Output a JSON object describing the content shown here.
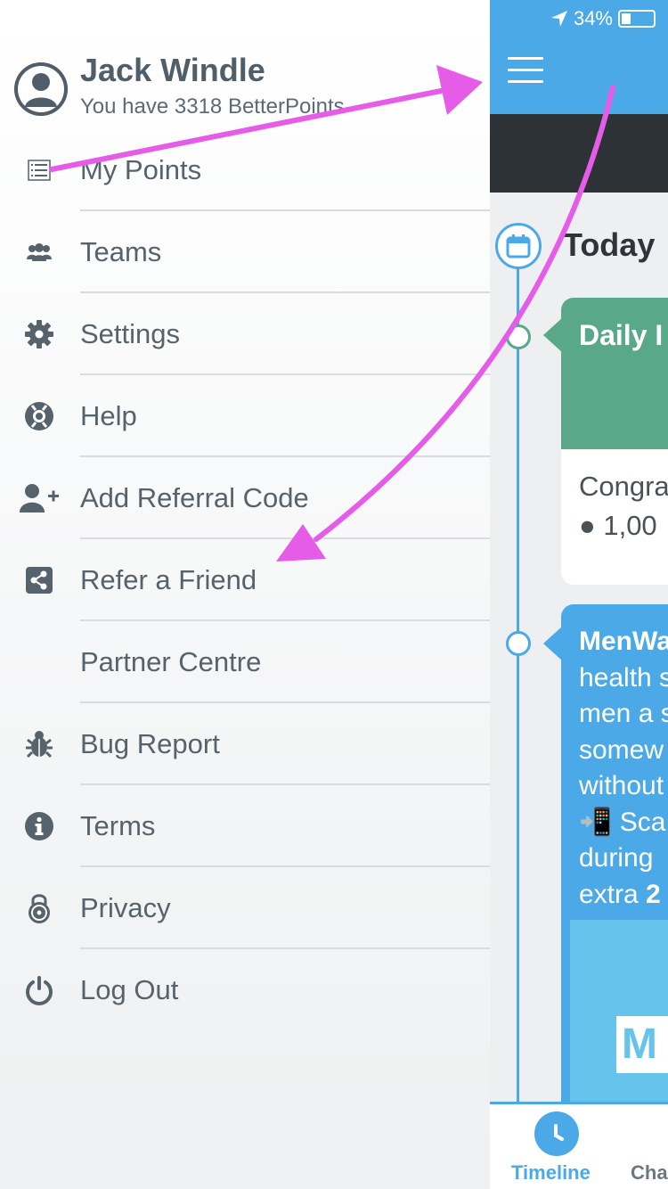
{
  "colors": {
    "primary_blue": "#4aa9e6",
    "green_card": "#5aa88a",
    "dark_band": "#2d3237",
    "menu_text": "#56636c",
    "annotation": "#e55ce8"
  },
  "status_bar": {
    "battery_text": "34%",
    "icons": [
      "location-arrow-icon",
      "battery-icon"
    ]
  },
  "profile": {
    "name": "Jack Windle",
    "subtitle": "You have 3318 BetterPoints"
  },
  "menu": {
    "items": [
      {
        "label": "My Points",
        "icon": "list-icon"
      },
      {
        "label": "Teams",
        "icon": "users-icon"
      },
      {
        "label": "Settings",
        "icon": "gear-icon"
      },
      {
        "label": "Help",
        "icon": "lifebuoy-icon"
      },
      {
        "label": "Add Referral Code",
        "icon": "user-plus-icon"
      },
      {
        "label": "Refer a Friend",
        "icon": "share-icon"
      },
      {
        "label": "Partner Centre",
        "icon": ""
      },
      {
        "label": "Bug Report",
        "icon": "bug-icon"
      },
      {
        "label": "Terms",
        "icon": "info-icon"
      },
      {
        "label": "Privacy",
        "icon": "padlock-icon"
      },
      {
        "label": "Log Out",
        "icon": "power-icon"
      }
    ]
  },
  "timeline": {
    "section_label": "Today",
    "card1": {
      "title": "Daily I",
      "line1": "Congra",
      "line2": "●  1,00"
    },
    "card2": {
      "line1": "MenWa",
      "line2": "health s",
      "line3": "men a s",
      "line4": "somew",
      "line5": "without",
      "line6": "📲 Sca",
      "line7": "during",
      "line8_prefix": "extra ",
      "line8_bold": "2",
      "logo_letter": "M"
    }
  },
  "tabbar": {
    "timeline_label": "Timeline",
    "chat_label": "Cha"
  }
}
